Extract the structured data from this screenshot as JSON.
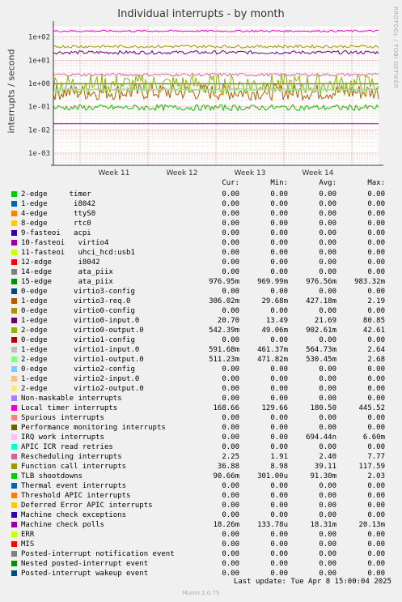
{
  "chart_data": {
    "type": "line",
    "title": "Individual interrupts - by month",
    "ylabel": "interrupts / second",
    "yscale": "log",
    "ylim": [
      0.0003,
      300
    ],
    "y_ticks": [
      "1e+02",
      "1e+01",
      "1e+00",
      "1e-01",
      "1e-02",
      "1e-03"
    ],
    "x_ticks": [
      "Week 11",
      "Week 12",
      "Week 13",
      "Week 14"
    ],
    "columns": [
      "Cur:",
      "Min:",
      "Avg:",
      "Max:"
    ],
    "series": [
      {
        "name": "2-edge     timer",
        "color": "#00cc00",
        "cur": "0.00",
        "min": "0.00",
        "avg": "0.00",
        "max": "0.00"
      },
      {
        "name": "1-edge      i8042",
        "color": "#0066b3",
        "cur": "0.00",
        "min": "0.00",
        "avg": "0.00",
        "max": "0.00"
      },
      {
        "name": "4-edge      ttyS0",
        "color": "#ff8000",
        "cur": "0.00",
        "min": "0.00",
        "avg": "0.00",
        "max": "0.00"
      },
      {
        "name": "8-edge      rtc0",
        "color": "#ffcc00",
        "cur": "0.00",
        "min": "0.00",
        "avg": "0.00",
        "max": "0.00"
      },
      {
        "name": "9-fasteoi   acpi",
        "color": "#330099",
        "cur": "0.00",
        "min": "0.00",
        "avg": "0.00",
        "max": "0.00"
      },
      {
        "name": "10-fasteoi   virtio4",
        "color": "#990099",
        "cur": "0.00",
        "min": "0.00",
        "avg": "0.00",
        "max": "0.00"
      },
      {
        "name": "11-fasteoi   uhci_hcd:usb1",
        "color": "#ccff00",
        "cur": "0.00",
        "min": "0.00",
        "avg": "0.00",
        "max": "0.00"
      },
      {
        "name": "12-edge      i8042",
        "color": "#ff0000",
        "cur": "0.00",
        "min": "0.00",
        "avg": "0.00",
        "max": "0.00"
      },
      {
        "name": "14-edge      ata_piix",
        "color": "#808080",
        "cur": "0.00",
        "min": "0.00",
        "avg": "0.00",
        "max": "0.00"
      },
      {
        "name": "15-edge      ata_piix",
        "color": "#008f00",
        "cur": "976.95m",
        "min": "969.99m",
        "avg": "976.56m",
        "max": "983.32m"
      },
      {
        "name": "0-edge      virtio3-config",
        "color": "#00487d",
        "cur": "0.00",
        "min": "0.00",
        "avg": "0.00",
        "max": "0.00"
      },
      {
        "name": "1-edge      virtio3-req.0",
        "color": "#b35a00",
        "cur": "306.02m",
        "min": "29.68m",
        "avg": "427.18m",
        "max": "2.19"
      },
      {
        "name": "0-edge      virtio0-config",
        "color": "#b38f00",
        "cur": "0.00",
        "min": "0.00",
        "avg": "0.00",
        "max": "0.00"
      },
      {
        "name": "1-edge      virtio0-input.0",
        "color": "#6b006b",
        "cur": "20.70",
        "min": "13.49",
        "avg": "21.69",
        "max": "80.85"
      },
      {
        "name": "2-edge      virtio0-output.0",
        "color": "#8fb300",
        "cur": "542.39m",
        "min": "49.06m",
        "avg": "902.61m",
        "max": "42.61"
      },
      {
        "name": "0-edge      virtio1-config",
        "color": "#b30000",
        "cur": "0.00",
        "min": "0.00",
        "avg": "0.00",
        "max": "0.00"
      },
      {
        "name": "1-edge      virtio1-input.0",
        "color": "#bebebe",
        "cur": "591.68m",
        "min": "461.37m",
        "avg": "564.73m",
        "max": "2.64"
      },
      {
        "name": "2-edge      virtio1-output.0",
        "color": "#80ff80",
        "cur": "511.23m",
        "min": "471.82m",
        "avg": "530.45m",
        "max": "2.68"
      },
      {
        "name": "0-edge      virtio2-config",
        "color": "#80c9ff",
        "cur": "0.00",
        "min": "0.00",
        "avg": "0.00",
        "max": "0.00"
      },
      {
        "name": "1-edge      virtio2-input.0",
        "color": "#ffc080",
        "cur": "0.00",
        "min": "0.00",
        "avg": "0.00",
        "max": "0.00"
      },
      {
        "name": "2-edge      virtio2-output.0",
        "color": "#ffe680",
        "cur": "0.00",
        "min": "0.00",
        "avg": "0.00",
        "max": "0.00"
      },
      {
        "name": "Non-maskable interrupts",
        "color": "#aa80ff",
        "cur": "0.00",
        "min": "0.00",
        "avg": "0.00",
        "max": "0.00"
      },
      {
        "name": "Local timer interrupts",
        "color": "#ee00cc",
        "cur": "168.66",
        "min": "129.66",
        "avg": "180.50",
        "max": "445.52"
      },
      {
        "name": "Spurious interrupts",
        "color": "#ff8080",
        "cur": "0.00",
        "min": "0.00",
        "avg": "0.00",
        "max": "0.00"
      },
      {
        "name": "Performance monitoring interrupts",
        "color": "#666600",
        "cur": "0.00",
        "min": "0.00",
        "avg": "0.00",
        "max": "0.00"
      },
      {
        "name": "IRQ work interrupts",
        "color": "#ffbfff",
        "cur": "0.00",
        "min": "0.00",
        "avg": "694.44n",
        "max": "6.60m"
      },
      {
        "name": "APIC ICR read retries",
        "color": "#00ffcc",
        "cur": "0.00",
        "min": "0.00",
        "avg": "0.00",
        "max": "0.00"
      },
      {
        "name": "Rescheduling interrupts",
        "color": "#cc6699",
        "cur": "2.25",
        "min": "1.91",
        "avg": "2.40",
        "max": "7.77"
      },
      {
        "name": "Function call interrupts",
        "color": "#999900",
        "cur": "36.88",
        "min": "8.98",
        "avg": "39.11",
        "max": "117.59"
      },
      {
        "name": "TLB shootdowns",
        "color": "#00cc00",
        "cur": "90.66m",
        "min": "301.00u",
        "avg": "91.30m",
        "max": "2.03"
      },
      {
        "name": "Thermal event interrupts",
        "color": "#0066b3",
        "cur": "0.00",
        "min": "0.00",
        "avg": "0.00",
        "max": "0.00"
      },
      {
        "name": "Threshold APIC interrupts",
        "color": "#ff8000",
        "cur": "0.00",
        "min": "0.00",
        "avg": "0.00",
        "max": "0.00"
      },
      {
        "name": "Deferred Error APIC interrupts",
        "color": "#ffcc00",
        "cur": "0.00",
        "min": "0.00",
        "avg": "0.00",
        "max": "0.00"
      },
      {
        "name": "Machine check exceptions",
        "color": "#330099",
        "cur": "0.00",
        "min": "0.00",
        "avg": "0.00",
        "max": "0.00"
      },
      {
        "name": "Machine check polls",
        "color": "#990099",
        "cur": "18.26m",
        "min": "133.78u",
        "avg": "18.31m",
        "max": "20.13m"
      },
      {
        "name": "ERR",
        "color": "#ccff00",
        "cur": "0.00",
        "min": "0.00",
        "avg": "0.00",
        "max": "0.00"
      },
      {
        "name": "MIS",
        "color": "#ff0000",
        "cur": "0.00",
        "min": "0.00",
        "avg": "0.00",
        "max": "0.00"
      },
      {
        "name": "Posted-interrupt notification event",
        "color": "#808080",
        "cur": "0.00",
        "min": "0.00",
        "avg": "0.00",
        "max": "0.00"
      },
      {
        "name": "Nested posted-interrupt event",
        "color": "#008f00",
        "cur": "0.00",
        "min": "0.00",
        "avg": "0.00",
        "max": "0.00"
      },
      {
        "name": "Posted-interrupt wakeup event",
        "color": "#00487d",
        "cur": "0.00",
        "min": "0.00",
        "avg": "0.00",
        "max": "0.00"
      }
    ]
  },
  "footer": {
    "last_update": "Last update: Tue Apr  8 15:00:04 2025",
    "munin": "Munin 2.0.75"
  },
  "side_label": "RRDTOOL / TOBI OETIKER"
}
